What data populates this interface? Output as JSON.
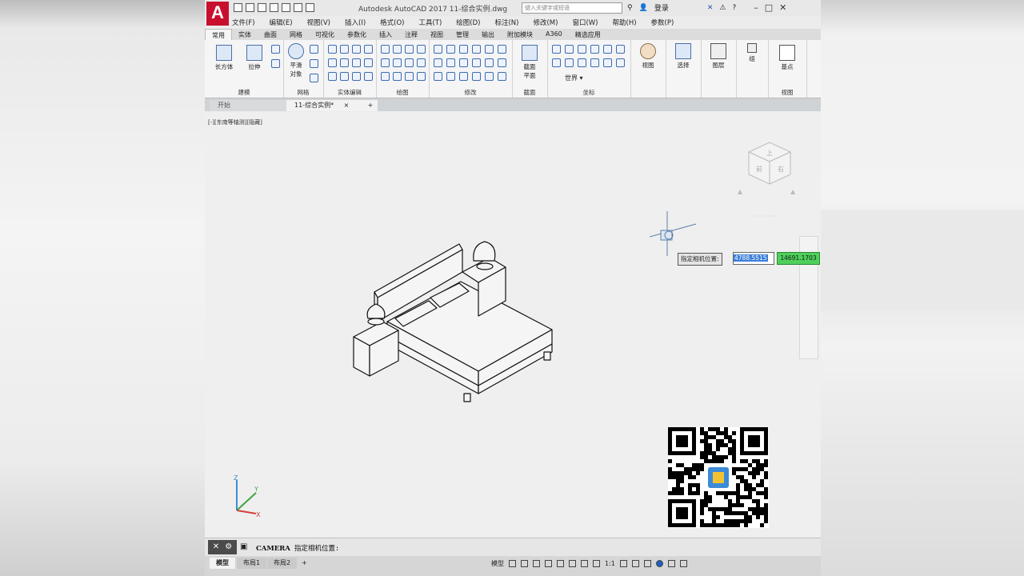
{
  "app": {
    "title": "Autodesk AutoCAD 2017    11-综合实例.dwg",
    "logo_letter": "A",
    "search_placeholder": "键入关键字或短语",
    "login_label": "登录",
    "help_label": "?"
  },
  "menu": [
    "文件(F)",
    "编辑(E)",
    "视图(V)",
    "插入(I)",
    "格式(O)",
    "工具(T)",
    "绘图(D)",
    "标注(N)",
    "修改(M)",
    "窗口(W)",
    "帮助(H)",
    "参数(P)"
  ],
  "ribbon_tabs": [
    "常用",
    "实体",
    "曲面",
    "网格",
    "可视化",
    "参数化",
    "插入",
    "注释",
    "视图",
    "管理",
    "输出",
    "附加模块",
    "A360",
    "精选应用"
  ],
  "ribbon": {
    "box_label": "长方体",
    "extrude_label": "拉伸",
    "smooth_label1": "平滑",
    "smooth_label2": "对象",
    "section_label1": "截面",
    "section_label2": "平面",
    "ucs_label": "世界",
    "view_label": "视图",
    "select_label": "选择",
    "layers_label": "图层",
    "group_label": "组",
    "base_label": "基点",
    "panels": {
      "modeling": "建模",
      "mesh": "网格",
      "solid_edit": "实体编辑",
      "draw": "绘图",
      "modify": "修改",
      "section": "截面",
      "coordinates": "坐标",
      "view": "视图"
    }
  },
  "doc_tabs": {
    "start": "开始",
    "active": "11-综合实例*",
    "add": "+"
  },
  "viewport": {
    "label": "[-][东南等轴测][隐藏]",
    "viewcube_top": "上",
    "viewcube_front": "前",
    "viewcube_right": "右",
    "ucs_x": "X",
    "ucs_y": "Y",
    "ucs_z": "Z"
  },
  "dynamic_input": {
    "prompt": "指定相机位置:",
    "x_value": "4788.5515",
    "y_value": "14691.1703"
  },
  "command": {
    "name": "CAMERA",
    "prompt": "指定相机位置:"
  },
  "layout_tabs": [
    "模型",
    "布局1",
    "布局2"
  ],
  "status": {
    "model_label": "模型",
    "scale": "1:1"
  }
}
